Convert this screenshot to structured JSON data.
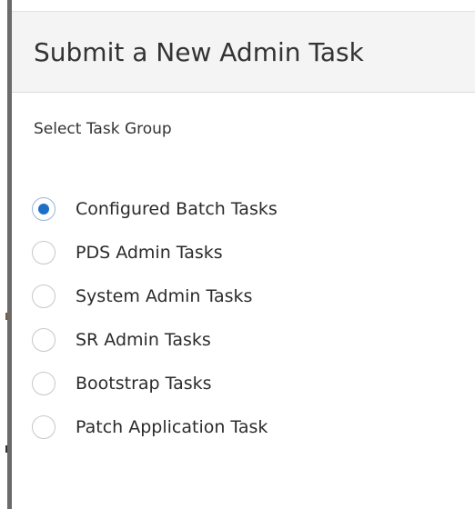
{
  "dialog": {
    "title": "Submit a New Admin Task",
    "section_label": "Select Task Group",
    "accent_color": "#1e6fc8",
    "options": [
      {
        "label": "Configured Batch Tasks",
        "selected": true
      },
      {
        "label": "PDS Admin Tasks",
        "selected": false
      },
      {
        "label": "System Admin Tasks",
        "selected": false
      },
      {
        "label": "SR Admin Tasks",
        "selected": false
      },
      {
        "label": "Bootstrap Tasks",
        "selected": false
      },
      {
        "label": "Patch Application Task",
        "selected": false
      }
    ]
  }
}
